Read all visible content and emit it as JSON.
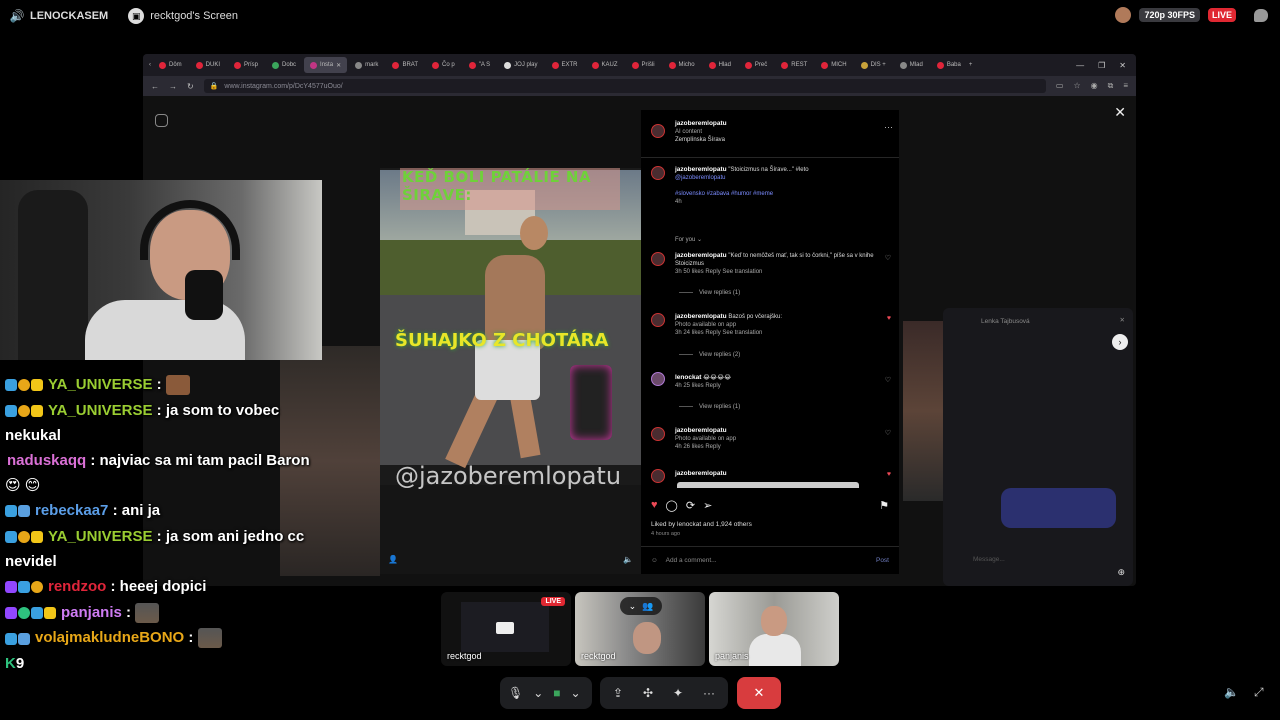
{
  "topbar": {
    "channel": "LENOCKASEM",
    "screen_title": "recktgod's Screen",
    "quality": "720p 30FPS",
    "live_badge": "LIVE"
  },
  "browser": {
    "tabs": [
      {
        "label": "Dôm",
        "active": false
      },
      {
        "label": "DUKI",
        "active": false
      },
      {
        "label": "Prísp",
        "active": false
      },
      {
        "label": "Dobc",
        "active": false
      },
      {
        "label": "Insta",
        "active": true
      },
      {
        "label": "mark",
        "active": false
      },
      {
        "label": "BRAT",
        "active": false
      },
      {
        "label": "Čo p",
        "active": false
      },
      {
        "label": "\"A S",
        "active": false
      },
      {
        "label": "JOJ play",
        "active": false
      },
      {
        "label": "EXTR",
        "active": false
      },
      {
        "label": "KAUZ",
        "active": false
      },
      {
        "label": "Prišli",
        "active": false
      },
      {
        "label": "Micho",
        "active": false
      },
      {
        "label": "Hlad",
        "active": false
      },
      {
        "label": "Preč",
        "active": false
      },
      {
        "label": "REST",
        "active": false
      },
      {
        "label": "MICH",
        "active": false
      },
      {
        "label": "DIS +",
        "active": false
      },
      {
        "label": "Mlad",
        "active": false
      },
      {
        "label": "Baba",
        "active": false
      }
    ],
    "url": "www.instagram.com/p/DcY4577uOuo/"
  },
  "reel": {
    "caption_top": "KEĎ BOLI PATÁLIE NA ŠIRAVE:",
    "caption_mid": "ŠUHAJKO Z CHOTÁRA",
    "watermark": "@jazoberemlopatu"
  },
  "post": {
    "author": "jazoberemlopatu",
    "ai_label": "AI content",
    "location": "Zemplínska Šírava",
    "caption": "\"Stoicizmus na Šírave...\" #leto",
    "caption_tag": "@jazoberemlopatu",
    "hashtags": "#slovensko #zabava #humor #meme",
    "caption_age": "4h",
    "for_you": "For you",
    "comments": [
      {
        "user": "jazoberemlopatu",
        "text": "\"Keď to nemôžeš mať, tak si to čorkni,\" píše sa v knihe Stoicizmus",
        "meta": "3h   50 likes   Reply   See translation",
        "replies": "View replies (1)",
        "liked": false
      },
      {
        "user": "jazoberemlopatu",
        "text": "Bazoš po včerajšku:",
        "sub": "Photo available on app",
        "meta": "3h   24 likes   Reply   See translation",
        "replies": "View replies (2)",
        "liked": true
      },
      {
        "user": "lenockat",
        "text": "😂😂😂😂",
        "meta": "4h   25 likes   Reply",
        "replies": "View replies (1)",
        "liked": false
      },
      {
        "user": "jazoberemlopatu",
        "text": "",
        "sub": "Photo available on app",
        "meta": "4h   26 likes   Reply",
        "replies": "",
        "liked": false
      },
      {
        "user": "jazoberemlopatu",
        "text": "",
        "meta": "",
        "replies": "",
        "liked": true
      }
    ],
    "liked_by": "Liked by lenockat and 1,924 others",
    "post_age": "4 hours ago",
    "add_comment": "Add a comment...",
    "post_button": "Post"
  },
  "dm": {
    "name": "Lenka Tajbusová",
    "message_placeholder": "Message..."
  },
  "chat": [
    {
      "user": "YA_UNIVERSE",
      "color": "#9acd32",
      "text": ":",
      "emote": true
    },
    {
      "user": "YA_UNIVERSE",
      "color": "#9acd32",
      "text": ": ja som to vobec nekukal",
      "emote": false
    },
    {
      "user": "naduskaqq",
      "color": "#da70d6",
      "text": ": najviac sa mi tam pacil Baron😍 😊",
      "emote": false
    },
    {
      "user": "rebeckaa7",
      "color": "#5b9ee8",
      "text": ": ani ja",
      "emote": false
    },
    {
      "user": "YA_UNIVERSE",
      "color": "#9acd32",
      "text": ": ja som ani jedno cc nevidel",
      "emote": false
    },
    {
      "user": "rendzoo",
      "color": "#e0253a",
      "text": ": heeej dopici",
      "emote": false
    },
    {
      "user": "panjanis",
      "color": "#cf7cf4",
      "text": ":",
      "emote": true
    },
    {
      "user": "volajmakludneBONO",
      "color": "#e8a718",
      "text": ":",
      "emote": true
    }
  ],
  "chat_counter": "9",
  "participants": [
    {
      "name": "recktgod",
      "live": "LIVE"
    },
    {
      "name": "recktgod"
    },
    {
      "name": "panjanis"
    }
  ]
}
